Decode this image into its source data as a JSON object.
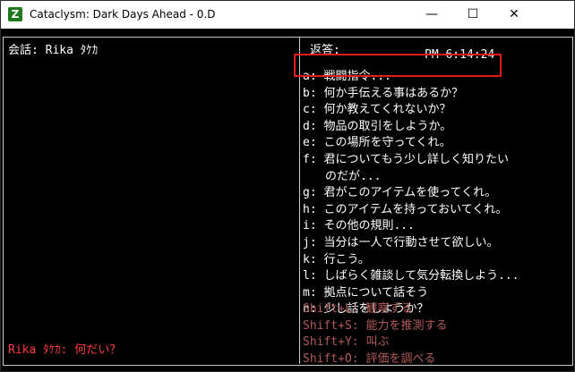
{
  "window": {
    "title": "Cataclysm: Dark Days Ahead - 0.D",
    "app_icon_glyph": "Z",
    "minimize_glyph": "—",
    "maximize_glyph": "☐",
    "close_glyph": "✕"
  },
  "left_pane": {
    "header": "会話: Rika ﾀｹｶ",
    "npc_line": "Rika ﾀｹｶ: 何だい？"
  },
  "right_pane": {
    "header": "返答:",
    "time": "PM 6:14:24",
    "options": [
      {
        "key": "a:",
        "text": "戦闘指令..."
      },
      {
        "key": "b:",
        "text": "何か手伝える事はあるか？"
      },
      {
        "key": "c:",
        "text": "何か教えてくれないか？"
      },
      {
        "key": "d:",
        "text": "物品の取引をしようか。"
      },
      {
        "key": "e:",
        "text": "この場所を守ってくれ。"
      },
      {
        "key": "f:",
        "text": "君についてもう少し詳しく知りたい"
      },
      {
        "key": "",
        "text": "のだが..."
      },
      {
        "key": "g:",
        "text": "君がこのアイテムを使ってくれ。"
      },
      {
        "key": "h:",
        "text": "このアイテムを持っておいてくれ。"
      },
      {
        "key": "i:",
        "text": "その他の規則..."
      },
      {
        "key": "j:",
        "text": "当分は一人で行動させて欲しい。"
      },
      {
        "key": "k:",
        "text": "行こう。"
      },
      {
        "key": "l:",
        "text": "しばらく雑談して気分転換しよう..."
      },
      {
        "key": "m:",
        "text": "拠点について話そう"
      },
      {
        "key": "n:",
        "text": "少し話をしようか？"
      }
    ],
    "shortcuts": [
      {
        "key": "Shift+L:",
        "text": "観察する"
      },
      {
        "key": "Shift+S:",
        "text": "能力を推測する"
      },
      {
        "key": "Shift+Y:",
        "text": "叫ぶ"
      },
      {
        "key": "Shift+O:",
        "text": "評価を調べる"
      }
    ]
  },
  "colors": {
    "terminal_bg": "#000000",
    "border": "#c8c8c8",
    "npc_text": "#ff3b3b",
    "shortcut_text": "#b45a5a",
    "highlight": "#e41b1b"
  }
}
